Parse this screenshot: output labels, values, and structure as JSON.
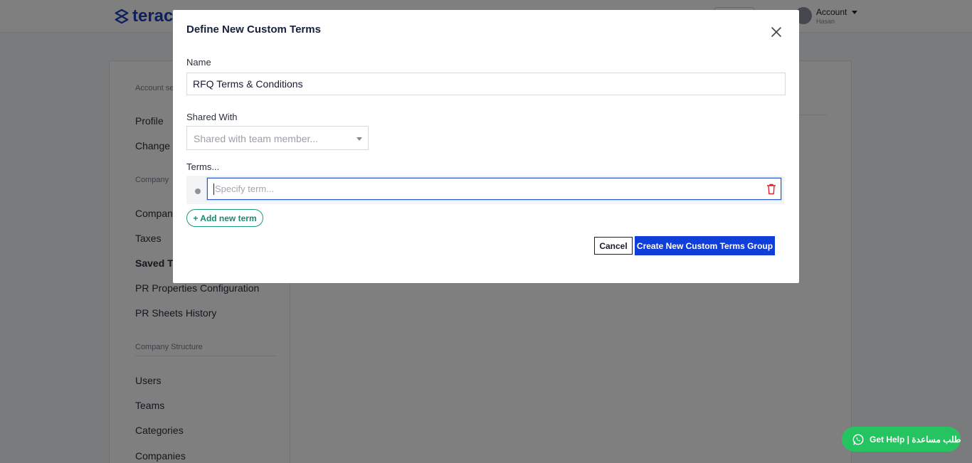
{
  "app": {
    "logo_text": "terac",
    "account_label": "Account",
    "account_sub": "Hasan"
  },
  "sidebar": {
    "sections": [
      {
        "title": "Account se",
        "items": [
          "Profile",
          "Change P"
        ]
      },
      {
        "title": "Company",
        "items": [
          "Compan",
          "Taxes",
          "Saved Te",
          "PR Properties Configuration",
          "PR Sheets History"
        ]
      },
      {
        "title": "Company Structure",
        "items": [
          "Users",
          "Teams",
          "Categories",
          "Companies"
        ]
      }
    ],
    "active_item": "Saved Te"
  },
  "modal": {
    "title": "Define New Custom Terms",
    "name_label": "Name",
    "name_value": "RFQ Terms & Conditions",
    "shared_label": "Shared With",
    "shared_placeholder": "Shared with team member...",
    "terms_label": "Terms...",
    "term_placeholder": "Specify term...",
    "add_term_label": "+ Add new term",
    "cancel_label": "Cancel",
    "create_label": "Create New Custom Terms Group"
  },
  "help": {
    "label": "Get Help | طلب مساعدة"
  },
  "colors": {
    "primary": "#0f3ed8",
    "accent_green": "#1a9a78",
    "help_green": "#25c460",
    "danger": "#e02424",
    "overlay": "rgba(0,0,0,0.5)"
  }
}
